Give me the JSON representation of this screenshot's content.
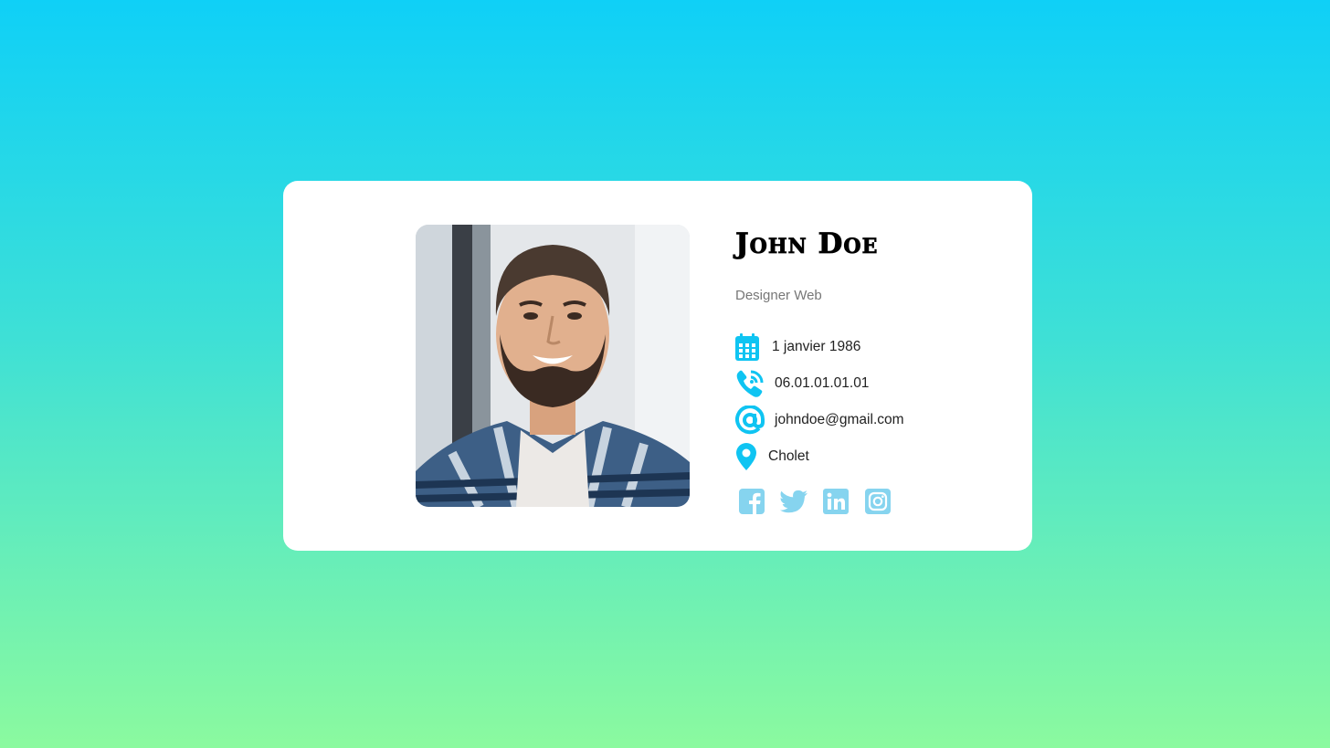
{
  "profile": {
    "name": "John Doe",
    "role": "Designer Web",
    "photo_alt": "photo-of-john-doe"
  },
  "details": [
    {
      "icon": "calendar-icon",
      "text": "1 janvier 1986"
    },
    {
      "icon": "phone-icon",
      "text": "06.01.01.01.01"
    },
    {
      "icon": "at-sign-icon",
      "text": "johndoe@gmail.com"
    },
    {
      "icon": "location-pin-icon",
      "text": "Cholet"
    }
  ],
  "socials": [
    {
      "icon": "facebook-icon"
    },
    {
      "icon": "twitter-icon"
    },
    {
      "icon": "linkedin-icon"
    },
    {
      "icon": "instagram-icon"
    }
  ],
  "colors": {
    "accent": "#0fc4f2",
    "social": "#86d4ef",
    "background_top": "#0fd0f7",
    "background_bottom": "#8bfa9f"
  }
}
